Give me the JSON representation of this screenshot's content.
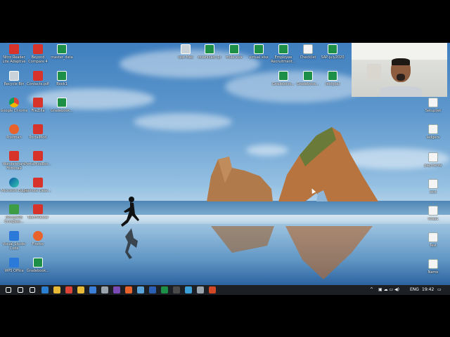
{
  "desktop": {
    "icons_left": [
      {
        "label": "Nitro Reader Lite Adaptive",
        "icon": "app-icon"
      },
      {
        "label": "Beyond Compare 4",
        "icon": "app-icon"
      },
      {
        "label": "master_data",
        "icon": "sheet-icon"
      },
      {
        "label": "Recycle Bin",
        "icon": "recycle-bin-icon"
      },
      {
        "label": "Contacts.pdf",
        "icon": "pdf-icon"
      },
      {
        "label": "Book1",
        "icon": "sheet-icon"
      },
      {
        "label": "Google Chrome",
        "icon": "chrome-icon"
      },
      {
        "label": "FileZilla",
        "icon": "app-icon"
      },
      {
        "label": "Gradebook...",
        "icon": "sheet-icon"
      },
      {
        "label": "Postman",
        "icon": "postman-icon"
      },
      {
        "label": "PortalMod",
        "icon": "app-icon"
      },
      {
        "label": "Wondershare Filmora9",
        "icon": "app-icon"
      },
      {
        "label": "PortalModBot...",
        "icon": "app-icon"
      },
      {
        "label": "Microsoft Edge",
        "icon": "edge-icon"
      },
      {
        "label": "Remote Desk...",
        "icon": "app-icon"
      },
      {
        "label": "MongoDB Compass...",
        "icon": "mongodb-icon"
      },
      {
        "label": "TeamViewer",
        "icon": "app-icon"
      },
      {
        "label": "Visual Studio Code",
        "icon": "vscode-icon"
      },
      {
        "label": "Firefox",
        "icon": "firefox-icon"
      },
      {
        "label": "WPS Office",
        "icon": "wps-icon"
      },
      {
        "label": "Gradebook...",
        "icon": "sheet-icon"
      }
    ],
    "icons_top": [
      {
        "label": "test files",
        "icon": "folder-icon"
      },
      {
        "label": "download (1)",
        "icon": "sheet-icon"
      },
      {
        "label": "mike.xlsx",
        "icon": "sheet-icon"
      },
      {
        "label": "virtual.xlsx",
        "icon": "sheet-icon"
      },
      {
        "label": "Employee Recruitment...",
        "icon": "sheet-icon"
      },
      {
        "label": "Checklist",
        "icon": "doc-icon"
      },
      {
        "label": "SAP-july2020",
        "icon": "sheet-icon"
      },
      {
        "label": "Gradebook...",
        "icon": "sheet-icon"
      },
      {
        "label": "Gradebook...",
        "icon": "sheet-icon"
      },
      {
        "label": "testgoal",
        "icon": "sheet-icon"
      }
    ],
    "icons_right": [
      {
        "label": "SetupIJet",
        "icon": "doc-icon"
      },
      {
        "label": "ledgers",
        "icon": "doc-icon"
      },
      {
        "label": "payments",
        "icon": "doc-icon"
      },
      {
        "label": "test",
        "icon": "doc-icon"
      },
      {
        "label": "vbsp1",
        "icon": "doc-icon"
      },
      {
        "label": "Test",
        "icon": "doc-icon"
      },
      {
        "label": "Name",
        "icon": "doc-icon"
      }
    ]
  },
  "taskbar": {
    "apps": [
      "start-icon",
      "search-icon",
      "task-view-icon",
      "vscode-icon",
      "file-explorer-icon",
      "chrome-icon",
      "folder-icon",
      "store-icon",
      "settings-icon",
      "vs-icon",
      "firefox-icon",
      "notepad-icon",
      "word-icon",
      "sheet-icon",
      "terminal-icon",
      "browser-icon",
      "app-icon",
      "powerpoint-icon"
    ],
    "language": "ENG",
    "time": "19:42"
  },
  "colors": {
    "taskbar": "#1c1f24",
    "sky": "#5d97cc",
    "sea": "#2f6ea8"
  }
}
